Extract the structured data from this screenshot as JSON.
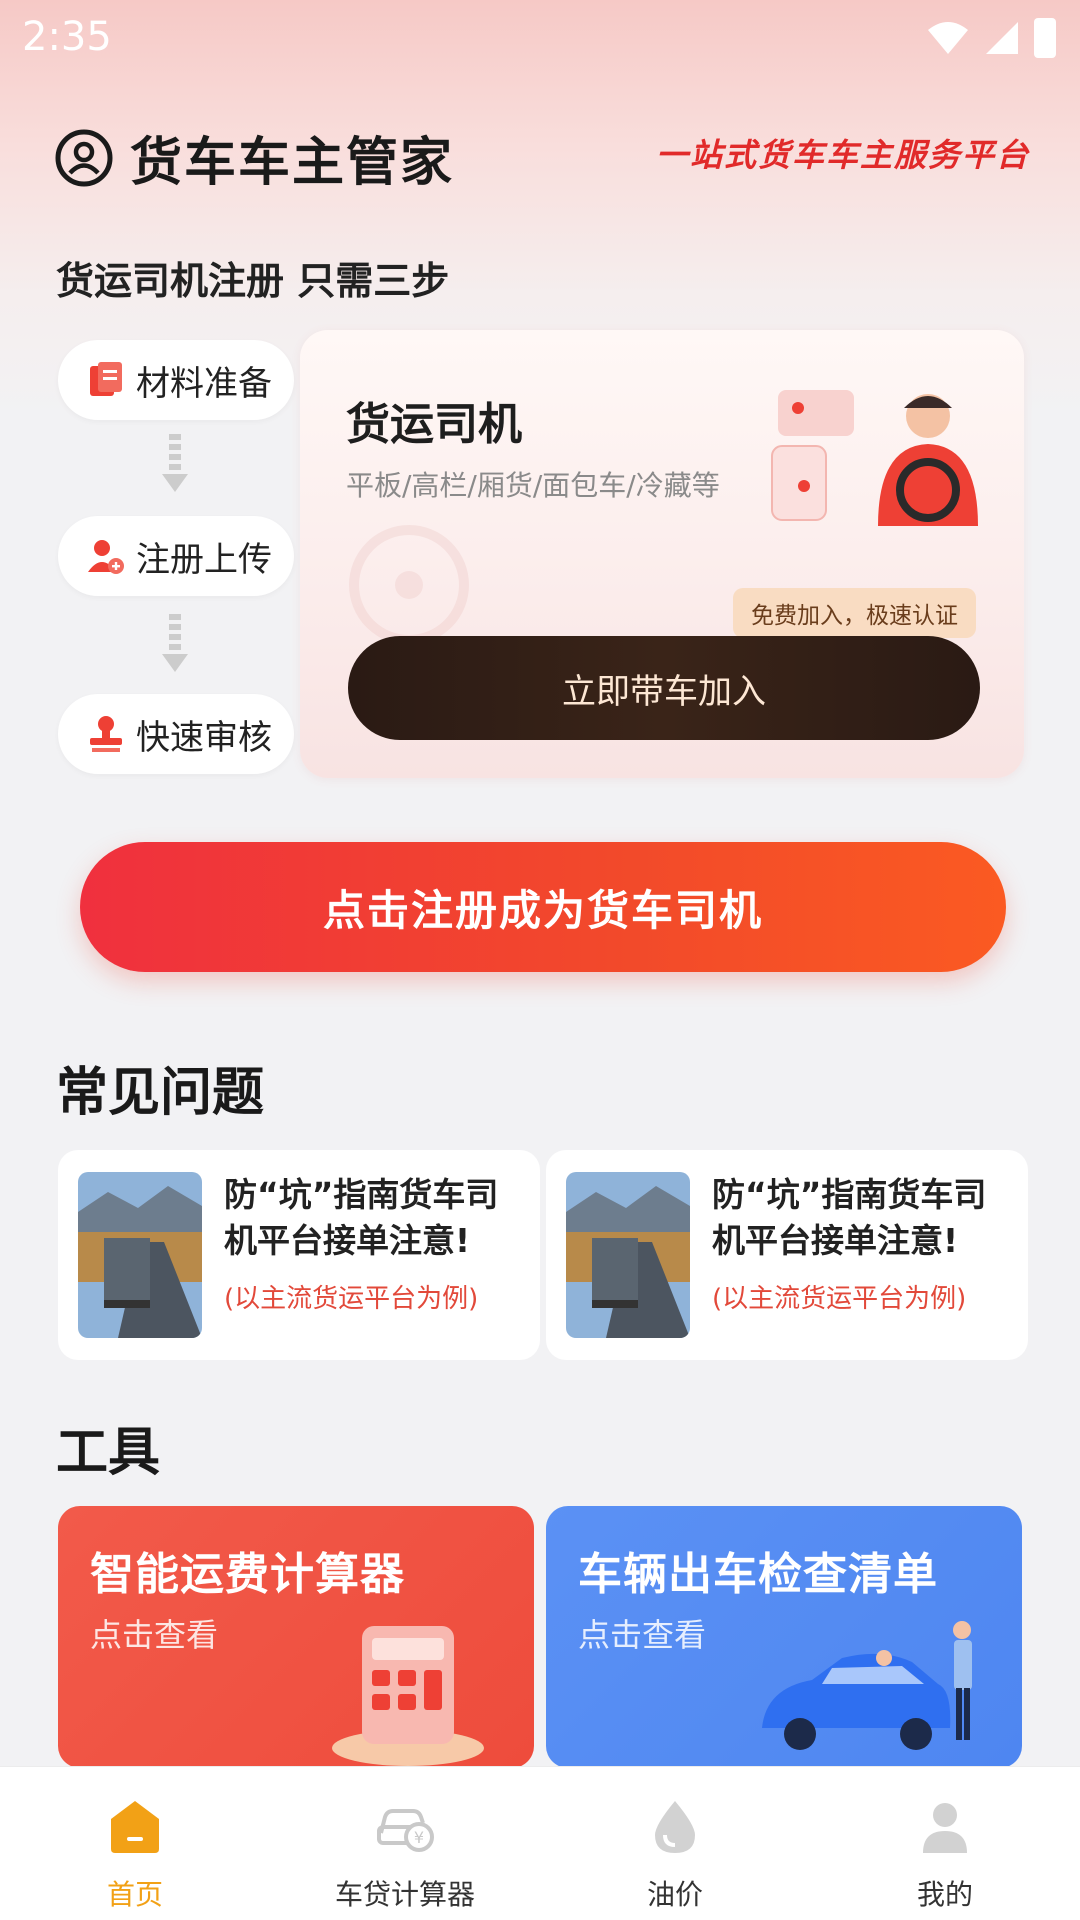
{
  "status_bar": {
    "time": "2:35"
  },
  "header": {
    "title": "货车车主管家",
    "slogan": "一站式货车车主服务平台"
  },
  "register": {
    "subtitle": "货运司机注册 只需三步",
    "steps": [
      {
        "label": "材料准备",
        "icon": "document-icon"
      },
      {
        "label": "注册上传",
        "icon": "add-user-icon"
      },
      {
        "label": "快速审核",
        "icon": "stamp-icon"
      }
    ]
  },
  "driver_card": {
    "title": "货运司机",
    "subtitle": "平板/高栏/厢货/面包车/冷藏等",
    "badge": "免费加入，极速认证",
    "button": "立即带车加入"
  },
  "main_button": "点击注册成为货车司机",
  "faq": {
    "title": "常见问题",
    "items": [
      {
        "title": "防“坑”指南货车司机平台接单注意!",
        "note": "(以主流货运平台为例)"
      },
      {
        "title": "防“坑”指南货车司机平台接单注意!",
        "note": "(以主流货运平台为例)"
      }
    ]
  },
  "tools": {
    "title": "工具",
    "items": [
      {
        "title": "智能运费计算器",
        "sub": "点击查看",
        "color": "#f25a4a"
      },
      {
        "title": "车辆出车检查清单",
        "sub": "点击查看",
        "color": "#5b91f4"
      }
    ]
  },
  "nav": {
    "items": [
      {
        "label": "首页",
        "icon": "home-icon",
        "active": true
      },
      {
        "label": "车贷计算器",
        "icon": "car-loan-icon",
        "active": false
      },
      {
        "label": "油价",
        "icon": "oil-drop-icon",
        "active": false
      },
      {
        "label": "我的",
        "icon": "profile-icon",
        "active": false
      }
    ]
  },
  "colors": {
    "accent": "#f2a116",
    "primary_red": "#f0303e",
    "slogan_red": "#e12a2a"
  }
}
